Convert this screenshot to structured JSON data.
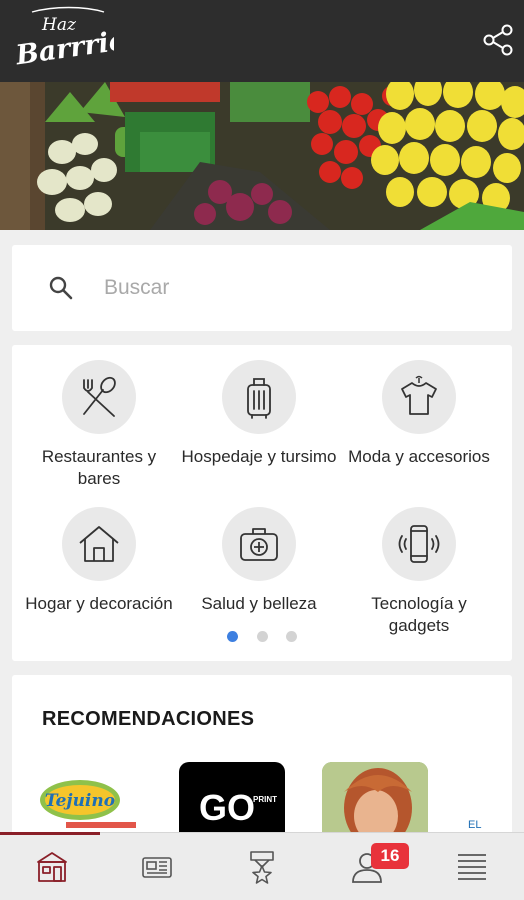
{
  "app": {
    "logo_line1": "Haz",
    "logo_line2": "Barrrio",
    "colors": {
      "topbar": "#2d2d2d",
      "accent": "#8a1f28",
      "badge": "#e8323b",
      "active_dot": "#3d7fe0"
    }
  },
  "search": {
    "placeholder": "Buscar"
  },
  "categories": [
    {
      "label": "Restaurantes y bares",
      "icon": "fork-spoon-icon"
    },
    {
      "label": "Hospedaje y tursimo",
      "icon": "suitcase-icon"
    },
    {
      "label": "Moda y accesorios",
      "icon": "tshirt-icon"
    },
    {
      "label": "Hogar y decoración",
      "icon": "house-icon"
    },
    {
      "label": "Salud y belleza",
      "icon": "first-aid-kit-icon"
    },
    {
      "label": "Tecnología y gadgets",
      "icon": "smartphone-icon"
    }
  ],
  "pagination": {
    "total": 3,
    "active": 1
  },
  "recommendations": {
    "title": "RECOMENDACIONES",
    "items": [
      {
        "logo_text": "Tejuino"
      },
      {
        "logo_text": "GO",
        "logo_sub": "PRINT"
      },
      {
        "logo_text": ""
      },
      {
        "logo_text": "EL"
      }
    ]
  },
  "bottom_nav": {
    "items": [
      {
        "name": "home",
        "icon": "storefront-icon"
      },
      {
        "name": "news",
        "icon": "newspaper-icon"
      },
      {
        "name": "rewards",
        "icon": "medal-star-icon"
      },
      {
        "name": "profile",
        "icon": "user-icon",
        "badge": "16"
      },
      {
        "name": "menu",
        "icon": "hamburger-menu-icon"
      }
    ]
  }
}
